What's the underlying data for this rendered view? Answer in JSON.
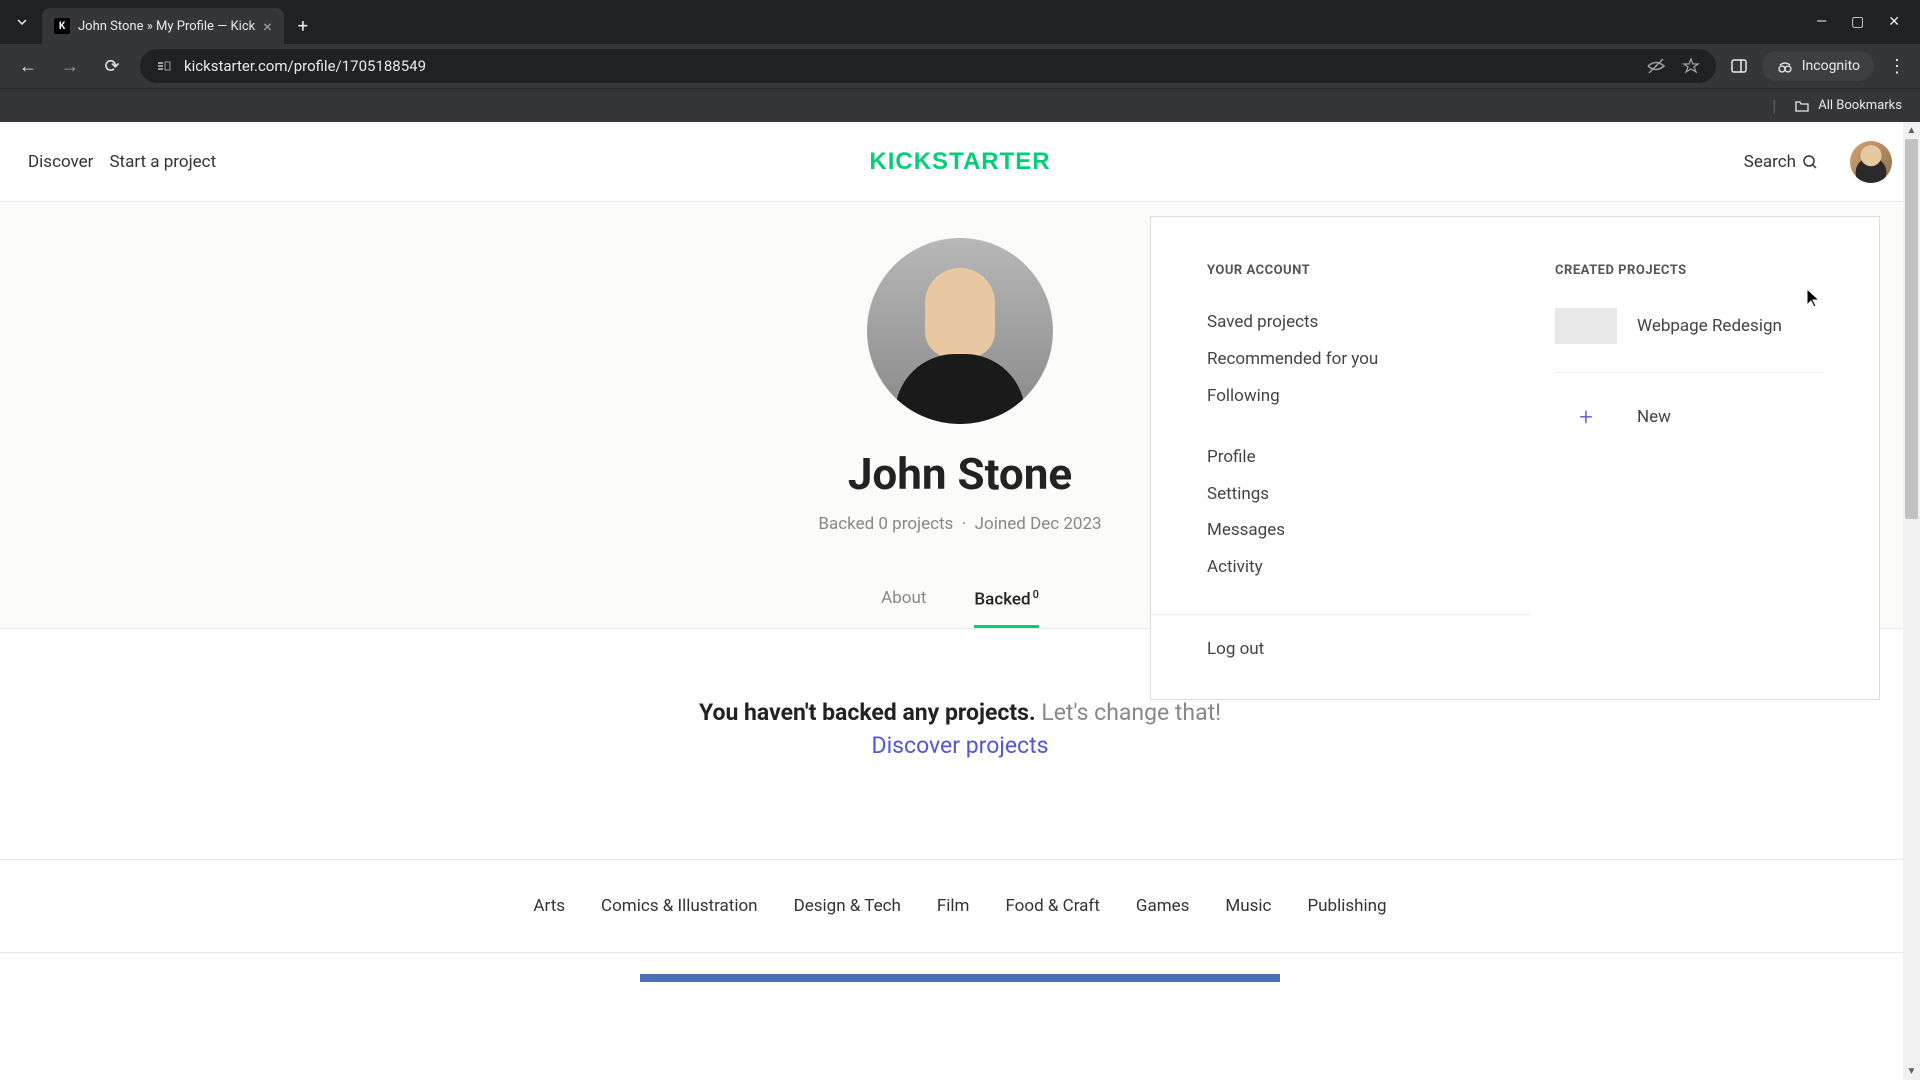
{
  "browser": {
    "tab_title": "John Stone » My Profile — Kick",
    "url": "kickstarter.com/profile/1705188549",
    "incognito_label": "Incognito",
    "bookmarks_label": "All Bookmarks"
  },
  "header": {
    "discover": "Discover",
    "start_project": "Start a project",
    "logo": "KICKSTARTER",
    "search": "Search"
  },
  "profile": {
    "name": "John Stone",
    "backed_stat": "Backed 0 projects",
    "joined_stat": "Joined Dec 2023",
    "separator": "·"
  },
  "tabs": {
    "about": "About",
    "backed": "Backed",
    "backed_count": "0"
  },
  "empty": {
    "bold": "You haven't backed any projects.",
    "light": "Let's change that!",
    "link": "Discover projects"
  },
  "categories": [
    "Arts",
    "Comics & Illustration",
    "Design & Tech",
    "Film",
    "Food & Craft",
    "Games",
    "Music",
    "Publishing"
  ],
  "dropdown": {
    "account_heading": "YOUR ACCOUNT",
    "projects_heading": "CREATED PROJECTS",
    "account_links_1": [
      "Saved projects",
      "Recommended for you",
      "Following"
    ],
    "account_links_2": [
      "Profile",
      "Settings",
      "Messages",
      "Activity"
    ],
    "logout": "Log out",
    "created_projects": [
      {
        "name": "Webpage Redesign"
      }
    ],
    "new_label": "New"
  }
}
